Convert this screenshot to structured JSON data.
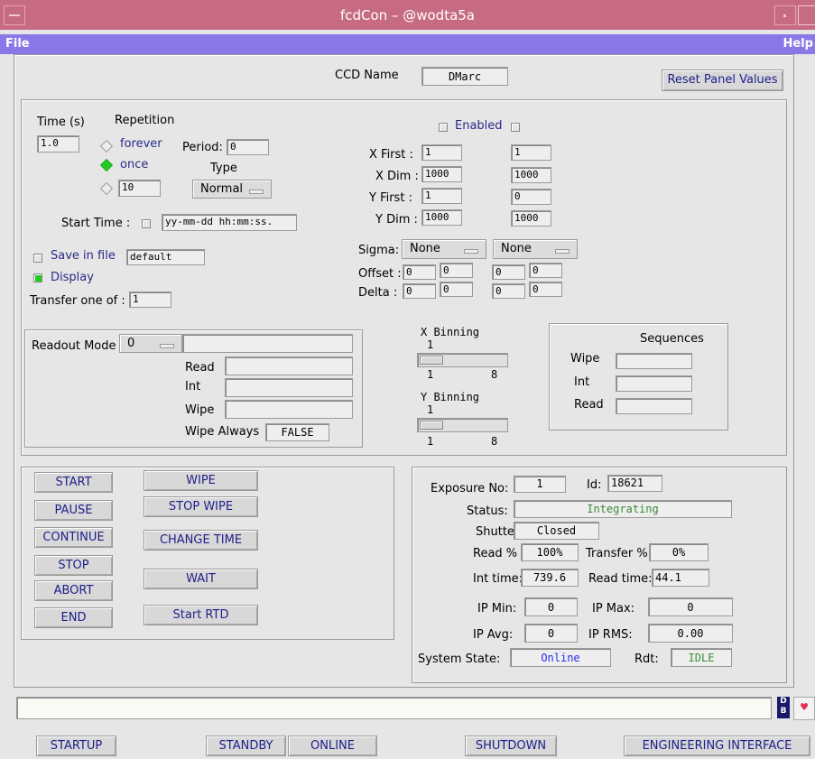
{
  "window": {
    "title": "fcdCon – @wodta5a"
  },
  "menu": {
    "file": "File",
    "help": "Help"
  },
  "header": {
    "ccd_label": "CCD Name",
    "ccd_value": "DMarc",
    "reset_button": "Reset Panel Values"
  },
  "exposure": {
    "time_label": "Time (s)",
    "time_value": "1.0",
    "repetition_label": "Repetition",
    "rep_forever": "forever",
    "rep_once": "once",
    "rep_count": "10",
    "period_label": "Period:",
    "period_value": "0",
    "type_label": "Type",
    "type_value": "Normal",
    "start_time_label": "Start Time :",
    "start_time_value": "yy-mm-dd hh:mm:ss.",
    "save_label": "Save in file",
    "save_value": "default",
    "display_label": "Display",
    "transfer_label": "Transfer one of :",
    "transfer_value": "1"
  },
  "window_cfg": {
    "enabled_label": "Enabled",
    "x_first_label": "X First :",
    "x_dim_label": "X Dim :",
    "y_first_label": "Y First :",
    "y_dim_label": "Y Dim :",
    "col1": [
      "1",
      "1000",
      "1",
      "1000"
    ],
    "col2": [
      "1",
      "1000",
      "0",
      "1000"
    ],
    "sigma_label": "Sigma:",
    "sigma1": "None",
    "sigma2": "None",
    "offset_label": "Offset :",
    "delta_label": "Delta :",
    "offset_vals": [
      "0",
      "0",
      "0",
      "0"
    ],
    "delta_vals": [
      "0",
      "0",
      "0",
      "0"
    ]
  },
  "readout": {
    "mode_label": "Readout Mode",
    "mode_value": "0",
    "read_label": "Read",
    "int_label": "Int",
    "wipe_label": "Wipe",
    "wipe_always_label": "Wipe Always",
    "wipe_always_value": "FALSE"
  },
  "binning": {
    "x_label": "X Binning",
    "x_value": "1",
    "x_min": "1",
    "x_max": "8",
    "y_label": "Y Binning",
    "y_value": "1",
    "y_min": "1",
    "y_max": "8"
  },
  "sequences": {
    "title": "Sequences",
    "wipe": "Wipe",
    "int": "Int",
    "read": "Read"
  },
  "controls": {
    "start": "START",
    "pause": "PAUSE",
    "continue": "CONTINUE",
    "stop": "STOP",
    "abort": "ABORT",
    "end": "END",
    "wipe": "WIPE",
    "stop_wipe": "STOP WIPE",
    "change_time": "CHANGE TIME",
    "wait": "WAIT",
    "start_rtd": "Start RTD"
  },
  "status": {
    "exposure_no_label": "Exposure No:",
    "exposure_no": "1",
    "id_label": "Id:",
    "id": "18621",
    "status_label": "Status:",
    "status": "Integrating",
    "shutter_label": "Shutter",
    "shutter": "Closed",
    "read_pct_label": "Read %",
    "read_pct": "100%",
    "transfer_pct_label": "Transfer %",
    "transfer_pct": "0%",
    "int_time_label": "Int time:",
    "int_time": "739.6",
    "read_time_label": "Read time:",
    "read_time": "44.1",
    "ip_min_label": "IP Min:",
    "ip_min": "0",
    "ip_max_label": "IP Max:",
    "ip_max": "0",
    "ip_avg_label": "IP Avg:",
    "ip_avg": "0",
    "ip_rms_label": "IP RMS:",
    "ip_rms": "0.00",
    "system_state_label": "System State:",
    "system_state": "Online",
    "rdt_label": "Rdt:",
    "rdt": "IDLE"
  },
  "bottom": {
    "message": "",
    "startup": "STARTUP",
    "standby": "STANDBY",
    "online": "ONLINE",
    "shutdown": "SHUTDOWN",
    "engineering": "ENGINEERING INTERFACE"
  }
}
